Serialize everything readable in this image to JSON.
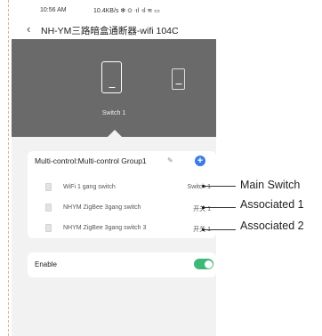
{
  "status_bar": {
    "time": "10:56 AM",
    "network": "10.4KB/s ✻ ⊙ ᐧıl ᐧıl ≋ ▭",
    "extra": ""
  },
  "header": {
    "back_icon": "‹",
    "title": "NH-YM三路暗盒通断器-wifi 104C"
  },
  "hero": {
    "selected_label": "Switch 1"
  },
  "group": {
    "title": "Multi-control:Multi-control Group1",
    "edit_icon": "✎",
    "add_icon": "+",
    "rows": [
      {
        "name": "WiFi 1 gang switch",
        "value": "Switch 1"
      },
      {
        "name": "NHYM ZigBee 3gang switch",
        "value": "开关 1"
      },
      {
        "name": "NHYM ZigBee 3gang switch 3",
        "value": "开关 1"
      }
    ]
  },
  "enable": {
    "label": "Enable",
    "on": true
  },
  "annotations": [
    {
      "label": "Main Switch"
    },
    {
      "label": "Associated 1"
    },
    {
      "label": "Associated 2"
    }
  ],
  "colors": {
    "hero_bg": "#6a6a6a",
    "accent_blue": "#3a7be8",
    "toggle_green": "#3cb878"
  }
}
